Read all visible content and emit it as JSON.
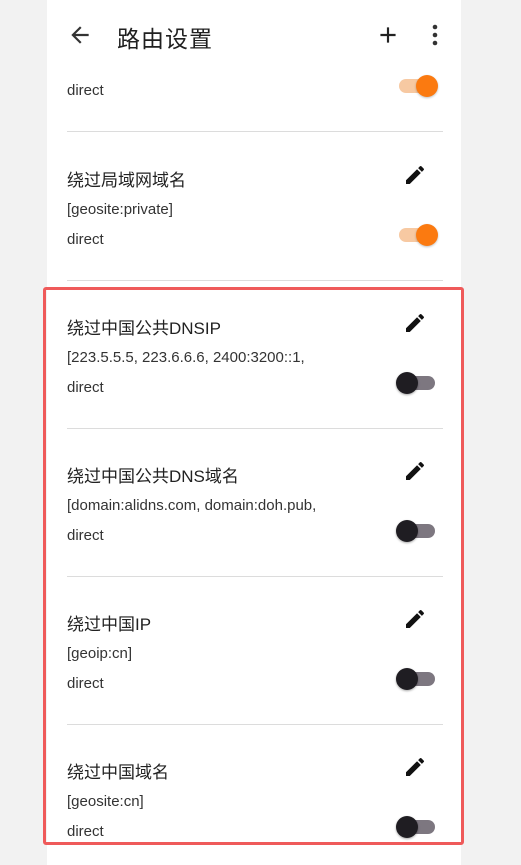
{
  "app": {
    "title": "路由设置",
    "icons": {
      "back": "arrow-back-icon",
      "add": "plus-icon",
      "more": "more-vert-icon",
      "edit": "pencil-icon"
    },
    "colors": {
      "accent": "#fb7a10",
      "highlight": "#ef5a5a",
      "switch_off_thumb": "#1f1d22",
      "switch_off_track": "#7d7780"
    }
  },
  "rules": [
    {
      "name": "",
      "domain": "",
      "outbound": "direct",
      "enabled": true
    },
    {
      "name": "绕过局域网域名",
      "domain": "[geosite:private]",
      "outbound": "direct",
      "enabled": true
    },
    {
      "name": "绕过中国公共DNSIP",
      "domain": "[223.5.5.5, 223.6.6.6, 2400:3200::1,",
      "outbound": "direct",
      "enabled": false
    },
    {
      "name": "绕过中国公共DNS域名",
      "domain": "[domain:alidns.com, domain:doh.pub,",
      "outbound": "direct",
      "enabled": false
    },
    {
      "name": "绕过中国IP",
      "domain": "[geoip:cn]",
      "outbound": "direct",
      "enabled": false
    },
    {
      "name": "绕过中国域名",
      "domain": "[geosite:cn]",
      "outbound": "direct",
      "enabled": false
    }
  ]
}
